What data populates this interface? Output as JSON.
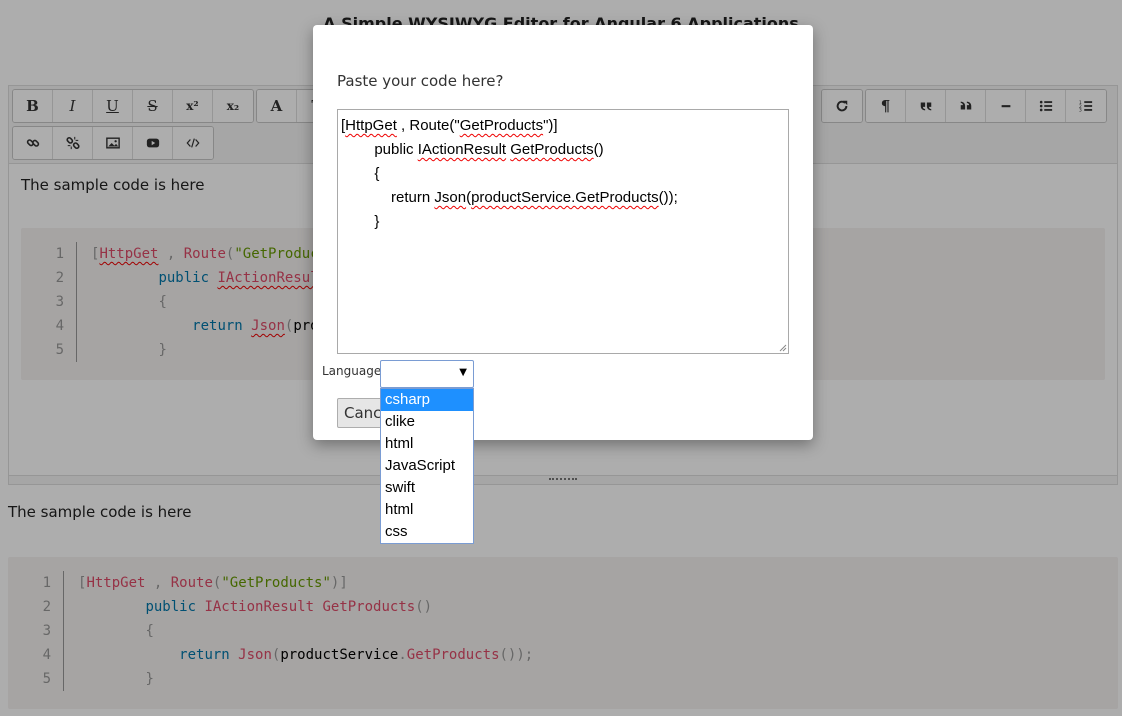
{
  "page": {
    "title": "A Simple WYSIWYG Editor for Angular 6 Applications"
  },
  "toolbar": {
    "bold": "B",
    "italic": "I",
    "underline": "U",
    "strike": "S",
    "superscript": "x²",
    "subscript": "x₂",
    "font_color": "A",
    "font_bg": "T",
    "paragraph": "¶"
  },
  "editor": {
    "intro": "The sample code is here",
    "code": {
      "line_numbers": [
        "1",
        "2",
        "3",
        "4",
        "5"
      ]
    }
  },
  "below": {
    "intro": "The sample code is here",
    "code": {
      "line_numbers": [
        "1",
        "2",
        "3",
        "4",
        "5"
      ],
      "lines": {
        "l1": {
          "p1": "[",
          "c1": "HttpGet",
          "p2": " , ",
          "c2": "Route",
          "p3": "(",
          "s1": "\"GetProducts\"",
          "p4": ")]"
        },
        "l2": {
          "indent": "        ",
          "kw": "public",
          "sp": " ",
          "cls": "IActionResult",
          "sp2": " ",
          "fn": "GetProducts",
          "p": "()"
        },
        "l3": {
          "indent": "        ",
          "p": "{"
        },
        "l4": {
          "indent": "            ",
          "kw": "return",
          "sp": " ",
          "fn": "Json",
          "p1": "(",
          "plain": "productService",
          "p2": ".",
          "fn2": "GetProducts",
          "p3": "());"
        },
        "l5": {
          "indent": "        ",
          "p": "}"
        }
      }
    }
  },
  "modal": {
    "prompt": "Paste your code here?",
    "textarea": {
      "l1": {
        "a": "[",
        "b": "HttpGet",
        "c": " , Route(\"",
        "d": "GetProducts",
        "e": "\")]"
      },
      "l2": {
        "indent": "        public ",
        "a": "IActionResult",
        "b": " ",
        "c": "GetProducts",
        "d": "()"
      },
      "l3": {
        "indent": "        {"
      },
      "l4": {
        "indent": "            return ",
        "a": "Json",
        "b": "(",
        "c": "productService.GetProducts",
        "d": "());"
      },
      "l5": {
        "indent": "        }"
      }
    },
    "language_label": "Language:",
    "language_value": "",
    "cancel_label": "Cancel",
    "language_options": [
      "csharp",
      "clike",
      "html",
      "JavaScript",
      "swift",
      "html",
      "css"
    ],
    "selected_option": "csharp"
  }
}
